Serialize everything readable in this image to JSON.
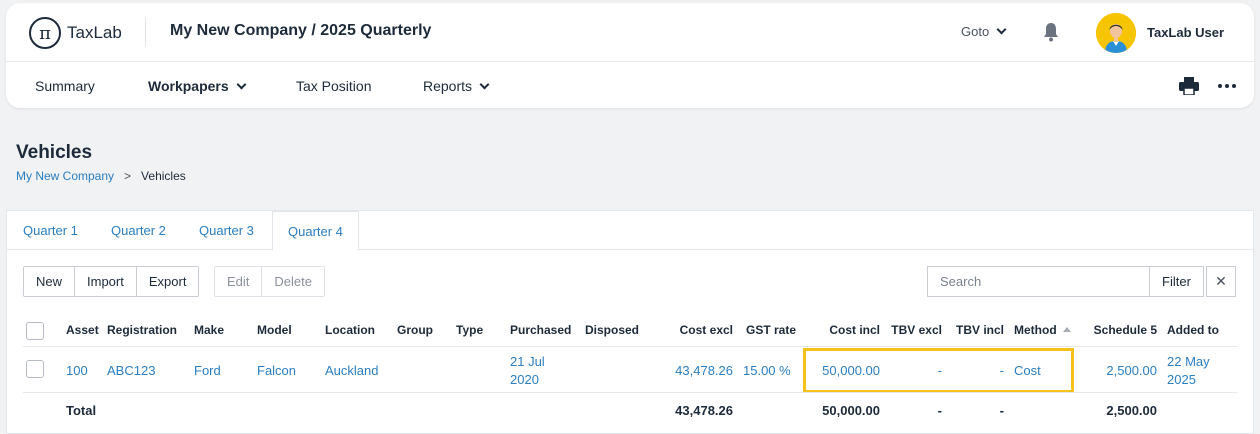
{
  "app": {
    "logo_text": "TaxLab",
    "logo_glyph": "π",
    "page_heading": "My New Company / 2025 Quarterly",
    "goto_label": "Goto",
    "user_name": "TaxLab User"
  },
  "nav": {
    "items": [
      {
        "label": "Summary"
      },
      {
        "label": "Workpapers"
      },
      {
        "label": "Tax Position"
      },
      {
        "label": "Reports"
      }
    ]
  },
  "page": {
    "title": "Vehicles",
    "breadcrumb": {
      "parent": "My New Company",
      "separator": ">",
      "current": "Vehicles"
    }
  },
  "tabs": [
    {
      "label": "Quarter 1"
    },
    {
      "label": "Quarter 2"
    },
    {
      "label": "Quarter 3"
    },
    {
      "label": "Quarter 4",
      "active": true
    }
  ],
  "toolbar": {
    "new_label": "New",
    "import_label": "Import",
    "export_label": "Export",
    "edit_label": "Edit",
    "delete_label": "Delete",
    "search_placeholder": "Search",
    "filter_label": "Filter",
    "clear_label": "✕"
  },
  "table": {
    "columns": [
      "Asset",
      "Registration",
      "Make",
      "Model",
      "Location",
      "Group",
      "Type",
      "Purchased",
      "Disposed",
      "Cost excl",
      "GST rate",
      "Cost incl",
      "TBV excl",
      "TBV incl",
      "Method",
      "Schedule 5",
      "Added to"
    ],
    "rows": [
      {
        "asset": "100",
        "registration": "ABC123",
        "make": "Ford",
        "model": "Falcon",
        "location": "Auckland",
        "group": "",
        "type": "",
        "purchased_line1": "21 Jul",
        "purchased_line2": "2020",
        "disposed": "",
        "cost_excl": "43,478.26",
        "gst_rate": "15.00 %",
        "cost_incl": "50,000.00",
        "tbv_excl": "-",
        "tbv_incl": "-",
        "method": "Cost",
        "schedule5": "2,500.00",
        "added_line1": "22 May",
        "added_line2": "2025"
      }
    ],
    "total": {
      "label": "Total",
      "cost_excl": "43,478.26",
      "cost_incl": "50,000.00",
      "tbv_excl": "-",
      "tbv_incl": "-",
      "schedule5": "2,500.00"
    }
  },
  "colors": {
    "link": "#2b7ec1",
    "highlight": "#f5c21b",
    "text": "#1d2a3a"
  }
}
